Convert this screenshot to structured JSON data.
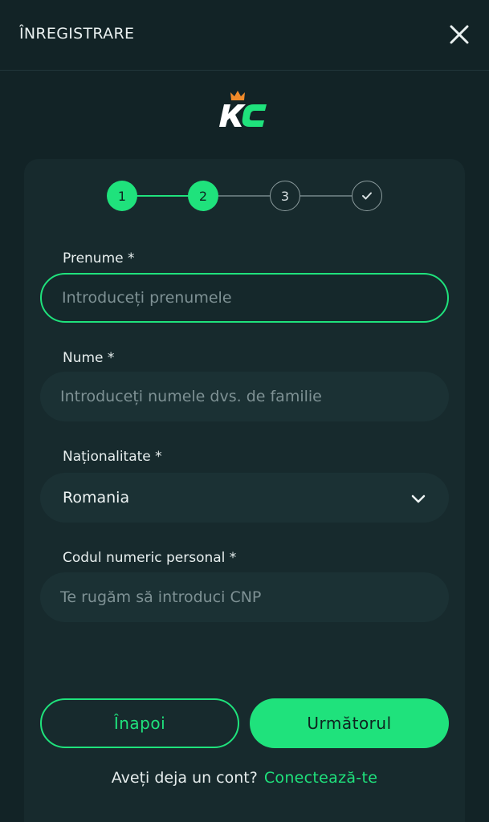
{
  "header": {
    "title": "ÎNREGISTRARE",
    "close_icon": "close-icon"
  },
  "logo": {
    "text": "KC",
    "icon": "crown-icon",
    "colors": {
      "k": "#ffffff",
      "c": "#1fe27c",
      "crown": "#f08a2a"
    }
  },
  "stepper": {
    "steps": [
      {
        "label": "1",
        "state": "done"
      },
      {
        "label": "2",
        "state": "current"
      },
      {
        "label": "3",
        "state": "pending"
      },
      {
        "label": "✓",
        "state": "pending",
        "icon": "check-icon"
      }
    ]
  },
  "form": {
    "first_name": {
      "label": "Prenume *",
      "placeholder": "Introduceți prenumele",
      "value": ""
    },
    "last_name": {
      "label": "Nume *",
      "placeholder": "Introduceți numele dvs. de familie",
      "value": ""
    },
    "nationality": {
      "label": "Naționalitate *",
      "value": "Romania",
      "icon": "chevron-down-icon"
    },
    "cnp": {
      "label": "Codul numeric personal *",
      "placeholder": "Te rugăm să introduci CNP",
      "value": ""
    }
  },
  "actions": {
    "back_label": "Înapoi",
    "next_label": "Următorul"
  },
  "footer": {
    "text": "Aveți deja un cont?",
    "link": "Conectează-te"
  },
  "colors": {
    "background": "#122326",
    "card": "#172a2d",
    "input": "#1b3134",
    "accent": "#1fe27c"
  }
}
